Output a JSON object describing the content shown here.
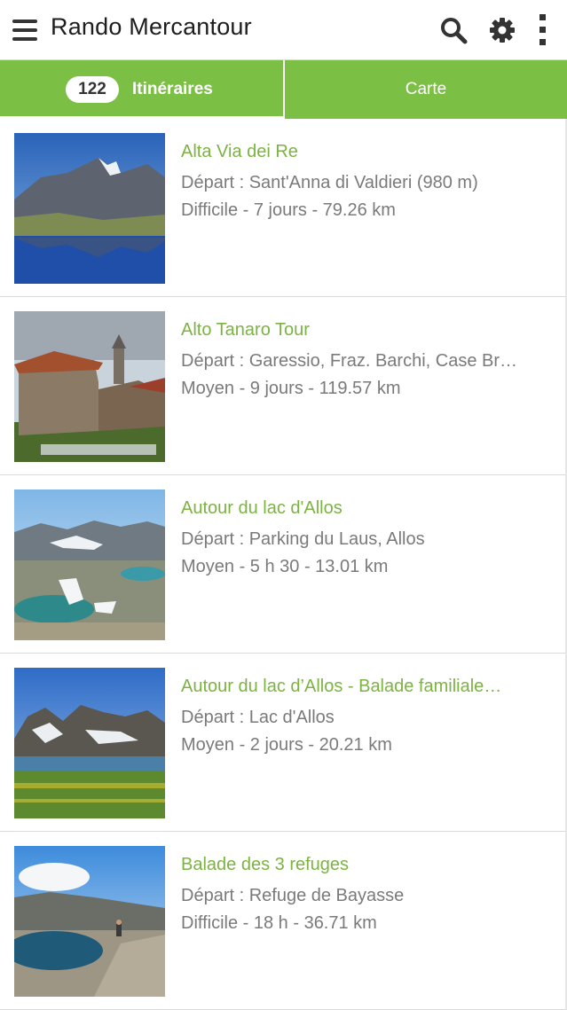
{
  "app": {
    "title": "Rando Mercantour"
  },
  "toolbar": {
    "icons": [
      "menu-icon",
      "search-icon",
      "gear-icon",
      "overflow-menu-icon"
    ]
  },
  "tabs": {
    "itineraries": {
      "count": "122",
      "label": "Itinéraires"
    },
    "map": {
      "label": "Carte"
    }
  },
  "colors": {
    "accent": "#7cbf45",
    "title_green": "#7cb342",
    "text_gray": "#7a7a7a"
  },
  "routes": [
    {
      "title": "Alta Via dei Re",
      "depart": "Départ : Sant'Anna di Valdieri (980 m)",
      "info": "Difficile - 7 jours - 79.26 km"
    },
    {
      "title": "Alto Tanaro Tour",
      "depart": "Départ : Garessio, Fraz. Barchi, Case Br…",
      "info": "Moyen - 9 jours - 119.57 km"
    },
    {
      "title": "Autour du lac d'Allos",
      "depart": "Départ : Parking du Laus, Allos",
      "info": "Moyen - 5 h 30 - 13.01 km"
    },
    {
      "title": "Autour du lac d’Allos - Balade familiale…",
      "depart": "Départ : Lac d'Allos",
      "info": "Moyen - 2 jours - 20.21 km"
    },
    {
      "title": "Balade des 3 refuges",
      "depart": "Départ : Refuge de Bayasse",
      "info": "Difficile - 18 h - 36.71 km"
    }
  ]
}
